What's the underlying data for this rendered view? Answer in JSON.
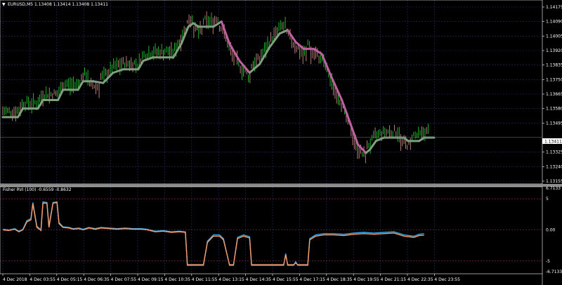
{
  "symbol_header": "EURUSD,M5  1.13408 1.13414 1.13408 1.13411",
  "indicator_header": "Fisher RVI (100) -0.6559 -0.8632",
  "colors": {
    "background": "#000000",
    "grid": "#1f2f6a",
    "bull_candle": "#22c52e",
    "bear_candle": "#c98a84",
    "trend_line_up": "#7f9f7f",
    "trend_line_down": "#c060a0",
    "fisher_line": "#ff9b66",
    "signal_line": "#2aa7e8",
    "level_line": "#a0306a",
    "price_label_bg": "#ffffff"
  },
  "price_axis": {
    "labels": [
      "1.14175",
      "1.14090",
      "1.14005",
      "1.13920",
      "1.13835",
      "1.13750",
      "1.13665",
      "1.13580",
      "1.13495",
      "1.13411",
      "1.13325",
      "1.13240",
      "1.13155"
    ],
    "current_price": "1.13411"
  },
  "indicator_axis": {
    "labels": [
      "6.7133",
      "5",
      "0.00",
      "-5",
      "-6.7133"
    ]
  },
  "time_axis": {
    "labels": [
      "4 Dec 2018",
      "4 Dec 03:55",
      "4 Dec 05:15",
      "4 Dec 06:35",
      "4 Dec 07:55",
      "4 Dec 09:15",
      "4 Dec 10:35",
      "4 Dec 11:55",
      "4 Dec 13:15",
      "4 Dec 14:35",
      "4 Dec 15:55",
      "4 Dec 17:15",
      "4 Dec 18:35",
      "4 Dec 19:55",
      "4 Dec 21:15",
      "4 Dec 22:35",
      "4 Dec 23:55"
    ]
  },
  "chart_data": [
    {
      "type": "line",
      "title": "EURUSD,M5",
      "ylim": [
        1.13155,
        1.14175
      ],
      "trend_line": [
        [
          0,
          1.1353
        ],
        [
          15,
          1.1353
        ],
        [
          20,
          1.1358
        ],
        [
          35,
          1.1358
        ],
        [
          40,
          1.1363
        ],
        [
          55,
          1.1363
        ],
        [
          60,
          1.1369
        ],
        [
          75,
          1.1369
        ],
        [
          80,
          1.1374
        ],
        [
          90,
          1.1374
        ],
        [
          100,
          1.1373
        ],
        [
          110,
          1.1379
        ],
        [
          120,
          1.1381
        ],
        [
          135,
          1.1381
        ],
        [
          140,
          1.1386
        ],
        [
          150,
          1.1388
        ],
        [
          160,
          1.1388
        ],
        [
          170,
          1.1388
        ],
        [
          178,
          1.1396
        ],
        [
          185,
          1.1406
        ],
        [
          190,
          1.1408
        ],
        [
          195,
          1.1406
        ],
        [
          210,
          1.1406
        ],
        [
          218,
          1.1409
        ],
        [
          226,
          1.1396
        ],
        [
          236,
          1.1386
        ],
        [
          246,
          1.1379
        ],
        [
          256,
          1.1384
        ],
        [
          266,
          1.1394
        ],
        [
          276,
          1.1402
        ],
        [
          284,
          1.1404
        ],
        [
          292,
          1.1397
        ],
        [
          300,
          1.1393
        ],
        [
          310,
          1.1393
        ],
        [
          318,
          1.139
        ],
        [
          328,
          1.1376
        ],
        [
          338,
          1.1363
        ],
        [
          346,
          1.135
        ],
        [
          354,
          1.1337
        ],
        [
          362,
          1.1332
        ],
        [
          366,
          1.1334
        ],
        [
          372,
          1.1339
        ],
        [
          380,
          1.1341
        ],
        [
          400,
          1.1341
        ],
        [
          404,
          1.1339
        ],
        [
          415,
          1.1339
        ],
        [
          420,
          1.1341
        ],
        [
          430,
          1.1341
        ]
      ]
    },
    {
      "type": "line",
      "title": "Fisher RVI (100)",
      "ylim": [
        -6.7133,
        6.7133
      ],
      "series": [
        {
          "name": "-0.6559",
          "values": [
            [
              0,
              0.1
            ],
            [
              6,
              0.0
            ],
            [
              12,
              0.2
            ],
            [
              16,
              -0.2
            ],
            [
              20,
              0.1
            ],
            [
              24,
              1.5
            ],
            [
              28,
              1.8
            ],
            [
              30,
              4.4
            ],
            [
              34,
              0.6
            ],
            [
              38,
              0.0
            ],
            [
              40,
              4.5
            ],
            [
              44,
              4.4
            ],
            [
              46,
              0.6
            ],
            [
              50,
              4.4
            ],
            [
              54,
              4.5
            ],
            [
              56,
              1.2
            ],
            [
              60,
              0.5
            ],
            [
              66,
              0.4
            ],
            [
              70,
              0.2
            ],
            [
              76,
              0.3
            ],
            [
              80,
              0.1
            ],
            [
              86,
              0.4
            ],
            [
              92,
              0.2
            ],
            [
              98,
              0.4
            ],
            [
              106,
              0.3
            ],
            [
              114,
              0.2
            ],
            [
              122,
              0.3
            ],
            [
              130,
              0.2
            ],
            [
              138,
              0.2
            ],
            [
              144,
              0.1
            ],
            [
              152,
              -0.2
            ],
            [
              160,
              -0.1
            ],
            [
              168,
              -0.3
            ],
            [
              176,
              -0.2
            ],
            [
              182,
              -0.3
            ],
            [
              184,
              -5.7
            ],
            [
              186,
              -5.7
            ],
            [
              200,
              -5.7
            ],
            [
              204,
              -1.8
            ],
            [
              210,
              -0.8
            ],
            [
              216,
              -0.8
            ],
            [
              220,
              -1.4
            ],
            [
              226,
              -5.7
            ],
            [
              230,
              -5.7
            ],
            [
              234,
              -1.2
            ],
            [
              240,
              -0.8
            ],
            [
              246,
              -1.1
            ],
            [
              248,
              -5.7
            ],
            [
              262,
              -5.7
            ],
            [
              272,
              -5.7
            ],
            [
              280,
              -5.7
            ],
            [
              282,
              -3.8
            ],
            [
              284,
              -5.7
            ],
            [
              290,
              -5.7
            ],
            [
              292,
              -5.1
            ],
            [
              294,
              -5.7
            ],
            [
              300,
              -5.7
            ],
            [
              304,
              -5.7
            ],
            [
              306,
              -1.4
            ],
            [
              312,
              -0.8
            ],
            [
              320,
              -0.6
            ],
            [
              330,
              -0.6
            ],
            [
              340,
              -0.7
            ],
            [
              350,
              -0.5
            ],
            [
              360,
              -0.4
            ],
            [
              370,
              -0.5
            ],
            [
              380,
              -0.4
            ],
            [
              390,
              -0.3
            ],
            [
              400,
              -0.8
            ],
            [
              410,
              -1.0
            ],
            [
              415,
              -0.7
            ],
            [
              420,
              -0.6
            ]
          ]
        },
        {
          "name": "-0.8632",
          "values": [
            [
              0,
              0.0
            ],
            [
              6,
              -0.1
            ],
            [
              12,
              0.1
            ],
            [
              16,
              -0.3
            ],
            [
              20,
              0.0
            ],
            [
              24,
              1.3
            ],
            [
              28,
              1.6
            ],
            [
              30,
              4.2
            ],
            [
              34,
              0.4
            ],
            [
              38,
              -0.1
            ],
            [
              40,
              4.3
            ],
            [
              44,
              4.3
            ],
            [
              46,
              0.4
            ],
            [
              50,
              4.3
            ],
            [
              54,
              4.4
            ],
            [
              56,
              1.0
            ],
            [
              60,
              0.4
            ],
            [
              66,
              0.3
            ],
            [
              70,
              0.1
            ],
            [
              76,
              0.2
            ],
            [
              80,
              0.0
            ],
            [
              86,
              0.3
            ],
            [
              92,
              0.1
            ],
            [
              98,
              0.3
            ],
            [
              106,
              0.2
            ],
            [
              114,
              0.1
            ],
            [
              122,
              0.2
            ],
            [
              130,
              0.1
            ],
            [
              138,
              0.1
            ],
            [
              144,
              0.0
            ],
            [
              152,
              -0.3
            ],
            [
              160,
              -0.2
            ],
            [
              168,
              -0.4
            ],
            [
              176,
              -0.3
            ],
            [
              182,
              -0.4
            ],
            [
              184,
              -5.6
            ],
            [
              186,
              -5.6
            ],
            [
              200,
              -5.6
            ],
            [
              204,
              -2.0
            ],
            [
              210,
              -1.0
            ],
            [
              216,
              -1.0
            ],
            [
              220,
              -1.6
            ],
            [
              226,
              -5.6
            ],
            [
              230,
              -5.6
            ],
            [
              234,
              -1.4
            ],
            [
              240,
              -1.0
            ],
            [
              246,
              -1.3
            ],
            [
              248,
              -5.6
            ],
            [
              262,
              -5.6
            ],
            [
              272,
              -5.6
            ],
            [
              280,
              -5.6
            ],
            [
              282,
              -4.0
            ],
            [
              284,
              -5.6
            ],
            [
              290,
              -5.6
            ],
            [
              292,
              -5.3
            ],
            [
              294,
              -5.6
            ],
            [
              300,
              -5.6
            ],
            [
              304,
              -5.6
            ],
            [
              306,
              -1.6
            ],
            [
              312,
              -1.0
            ],
            [
              320,
              -0.8
            ],
            [
              330,
              -0.8
            ],
            [
              340,
              -0.9
            ],
            [
              350,
              -0.7
            ],
            [
              360,
              -0.6
            ],
            [
              370,
              -0.7
            ],
            [
              380,
              -0.6
            ],
            [
              390,
              -0.5
            ],
            [
              400,
              -1.0
            ],
            [
              410,
              -1.2
            ],
            [
              415,
              -0.9
            ],
            [
              420,
              -0.86
            ]
          ]
        }
      ]
    }
  ]
}
